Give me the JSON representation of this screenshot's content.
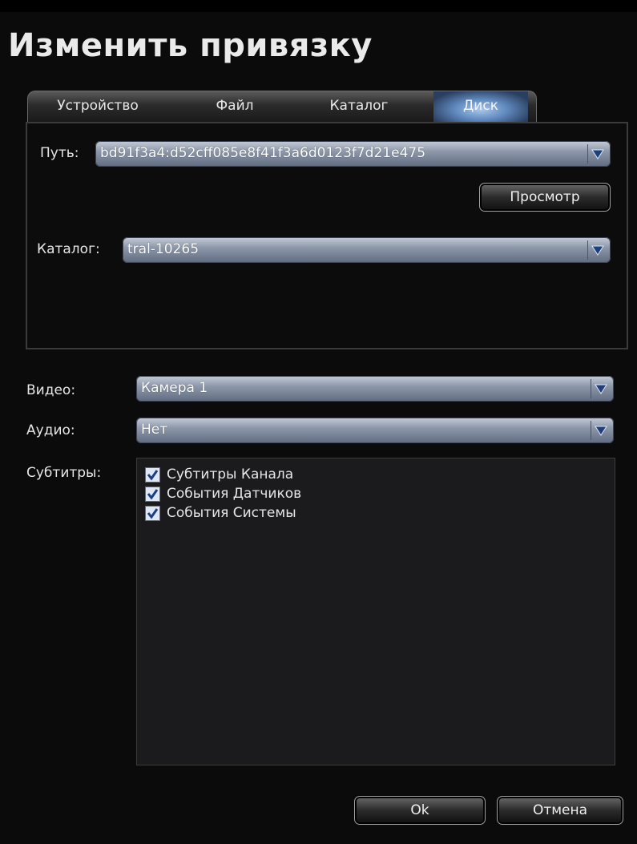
{
  "window": {
    "title": "Изменить привязку"
  },
  "tabs": [
    {
      "label": "Устройство",
      "active": false
    },
    {
      "label": "Файл",
      "active": false
    },
    {
      "label": "Каталог",
      "active": false
    },
    {
      "label": "Диск",
      "active": true
    }
  ],
  "disk": {
    "path_label": "Путь:",
    "path_value": "bd91f3a4:d52cff085e8f41f3a6d0123f7d21e475",
    "browse_label": "Просмотр",
    "catalog_label": "Каталог:",
    "catalog_value": "tral-10265"
  },
  "video": {
    "label": "Видео:",
    "value": "Камера 1"
  },
  "audio": {
    "label": "Аудио:",
    "value": "Нет"
  },
  "subtitles": {
    "label": "Субтитры:",
    "items": [
      {
        "label": "Субтитры Канала",
        "checked": true
      },
      {
        "label": "События Датчиков",
        "checked": true
      },
      {
        "label": "События Системы",
        "checked": true
      }
    ]
  },
  "footer": {
    "ok_label": "Ok",
    "cancel_label": "Отмена"
  },
  "colors": {
    "accent": "#5f88bd",
    "background": "#0b0b0b"
  },
  "icons": {
    "dropdown": "chevron-down-icon",
    "checkbox": "checkmark-icon"
  }
}
